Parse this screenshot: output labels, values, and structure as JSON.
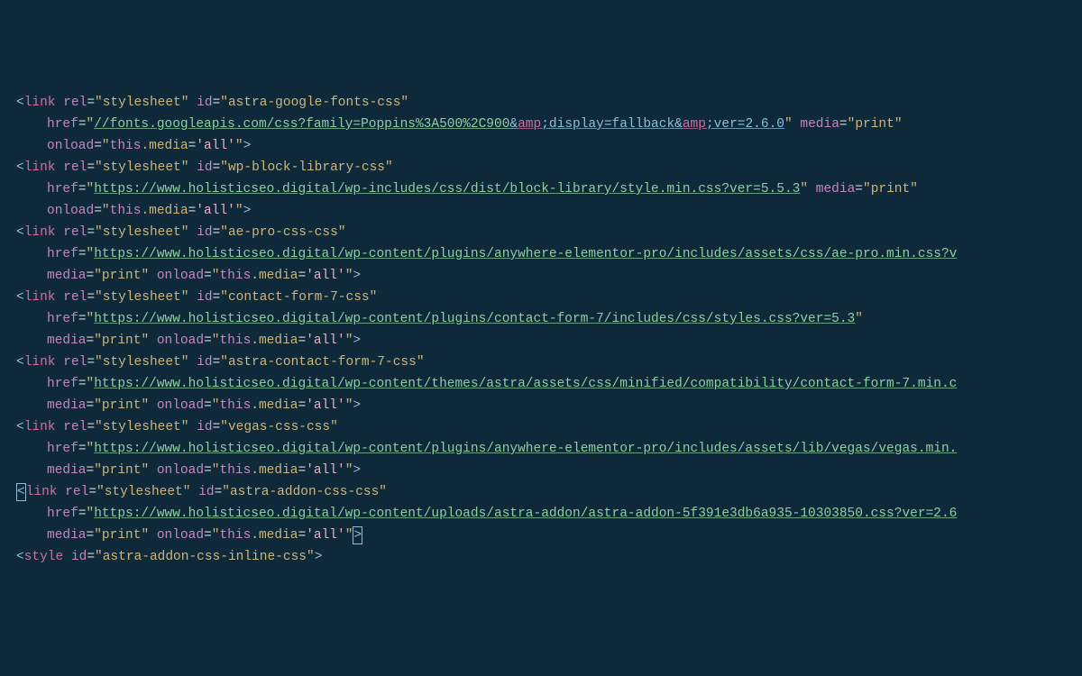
{
  "strings": {
    "stylesheet": "stylesheet",
    "print": "print",
    "onload_js": "this.media='all'"
  },
  "links": [
    {
      "id": "astra-google-fonts-css",
      "href_main": "//fonts.googleapis.com/css?family=Poppins%3A500%2C900",
      "href_parts": [
        "display=fallback",
        "ver=2.6.0"
      ],
      "media": "print",
      "onload": true
    },
    {
      "id": "wp-block-library-css",
      "href_main": "https://www.holisticseo.digital/wp-includes/css/dist/block-library/style.min.css?ver=5.5.3",
      "media": "print",
      "onload": true
    },
    {
      "id": "ae-pro-css-css",
      "href_main": "https://www.holisticseo.digital/wp-content/plugins/anywhere-elementor-pro/includes/assets/css/ae-pro.min.css?v",
      "truncated": true,
      "media": "print",
      "onload": true,
      "media_inline": true
    },
    {
      "id": "contact-form-7-css",
      "href_main": "https://www.holisticseo.digital/wp-content/plugins/contact-form-7/includes/css/styles.css?ver=5.3",
      "media": "print",
      "onload": true,
      "media_newline": true
    },
    {
      "id": "astra-contact-form-7-css",
      "href_main": "https://www.holisticseo.digital/wp-content/themes/astra/assets/css/minified/compatibility/contact-form-7.min.c",
      "truncated": true,
      "media": "print",
      "onload": true,
      "media_inline": true
    },
    {
      "id": "vegas-css-css",
      "href_main": "https://www.holisticseo.digital/wp-content/plugins/anywhere-elementor-pro/includes/assets/lib/vegas/vegas.min.",
      "truncated": true,
      "media": "print",
      "onload": true,
      "media_inline": true
    },
    {
      "id": "astra-addon-css-css",
      "href_main": "https://www.holisticseo.digital/wp-content/uploads/astra-addon/astra-addon-5f391e3db6a935-10303850.css?ver=2.6",
      "truncated": true,
      "media": "print",
      "onload": true,
      "media_inline": true,
      "cursor_before_open": true,
      "cursor_after_close": true
    }
  ],
  "style_tag_id": "astra-addon-css-inline-css"
}
